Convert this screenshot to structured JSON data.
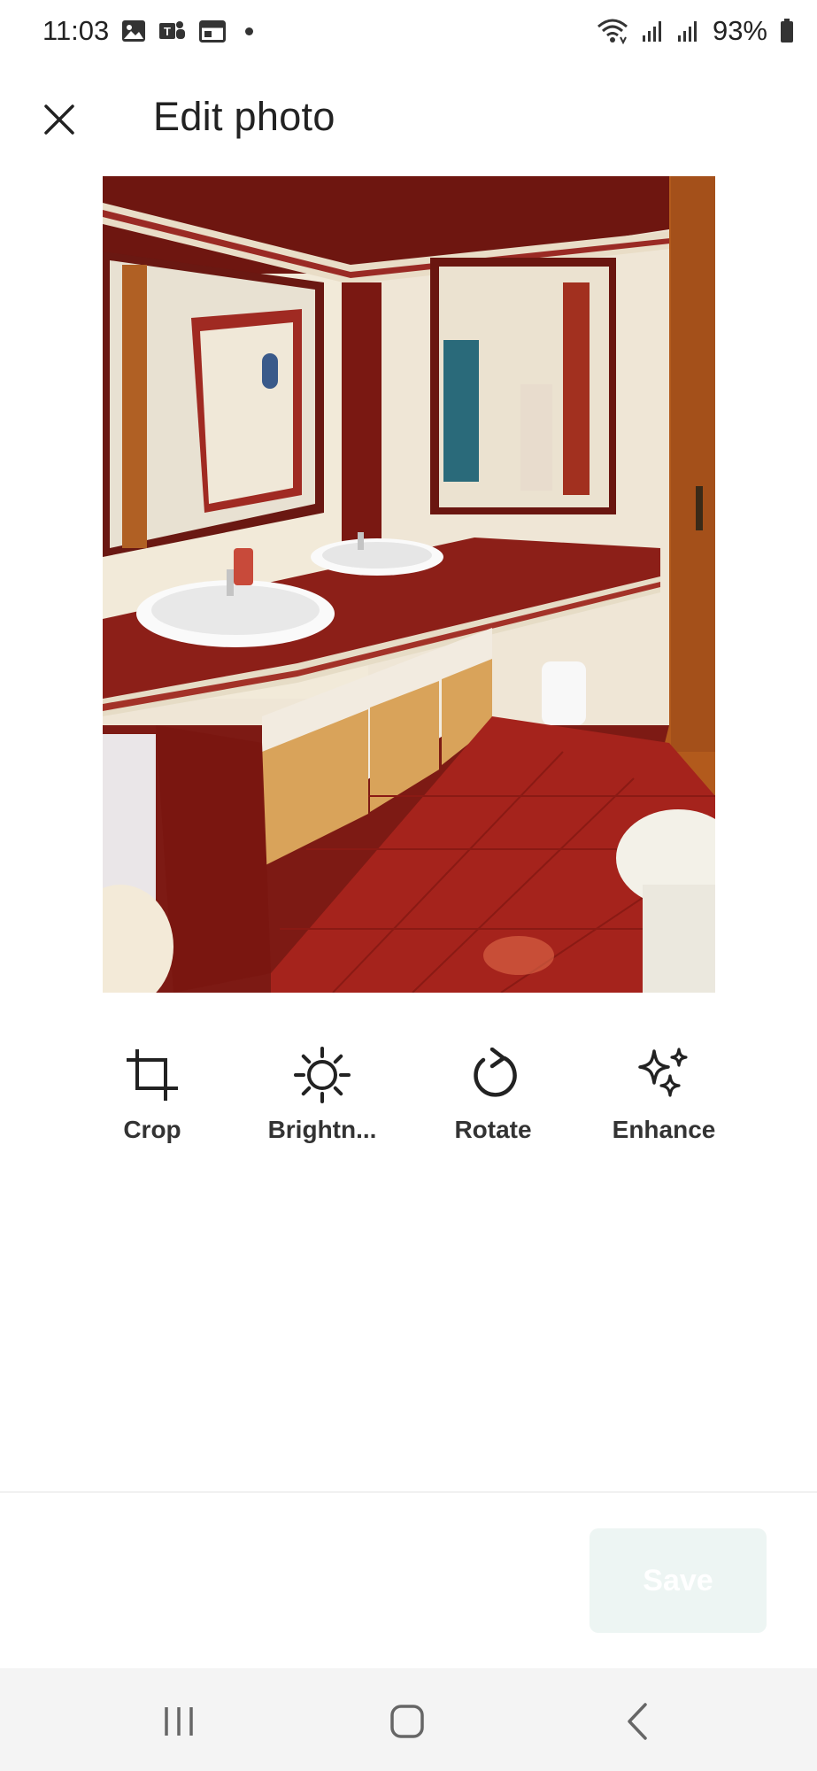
{
  "status_bar": {
    "time": "11:03",
    "left_icons": [
      "gallery-icon",
      "teams-icon",
      "calendar-icon"
    ],
    "right_icons": [
      "wifi-icon",
      "signal-icon",
      "signal-icon",
      "battery-icon"
    ],
    "battery": "93%"
  },
  "header": {
    "title": "Edit photo",
    "close_icon": "close-icon"
  },
  "photo": {
    "description_icon": "photo-preview"
  },
  "tools": [
    {
      "label": "Crop",
      "icon": "crop-icon"
    },
    {
      "label": "Brightn...",
      "icon": "brightness-icon"
    },
    {
      "label": "Rotate",
      "icon": "rotate-icon"
    },
    {
      "label": "Enhance",
      "icon": "sparkles-icon"
    }
  ],
  "footer": {
    "save_label": "Save"
  },
  "nav": {
    "icons": [
      "recent-apps-icon",
      "home-icon",
      "back-icon"
    ]
  },
  "colors": {
    "save_bg": "#edf5f3",
    "text": "#222222",
    "navbar_bg": "#f4f4f4"
  }
}
